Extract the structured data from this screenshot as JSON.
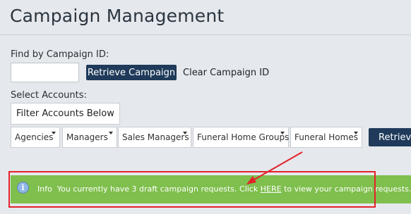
{
  "header": {
    "title": "Campaign Management"
  },
  "find": {
    "label": "Find by Campaign ID:",
    "input_value": "",
    "retrieve_label": "Retrieve Campaign",
    "clear_label": "Clear Campaign ID"
  },
  "accounts": {
    "label": "Select Accounts:",
    "filter_text": "Filter Accounts Below",
    "dropdowns": [
      {
        "label": "Agencies"
      },
      {
        "label": "Managers"
      },
      {
        "label": "Sales Managers"
      },
      {
        "label": "Funeral Home Groups"
      },
      {
        "label": "Funeral Homes"
      }
    ],
    "retrieve_label": "Retrieve"
  },
  "info_banner": {
    "icon": "info-icon",
    "prefix": "Info",
    "message": "You currently have 3 draft campaign requests. Click",
    "link_text": "HERE",
    "suffix": "to view your campaign requests."
  },
  "colors": {
    "primary_button": "#1f3a5a",
    "info_bar": "#7fbf4d",
    "annotation": "#e2222b"
  }
}
